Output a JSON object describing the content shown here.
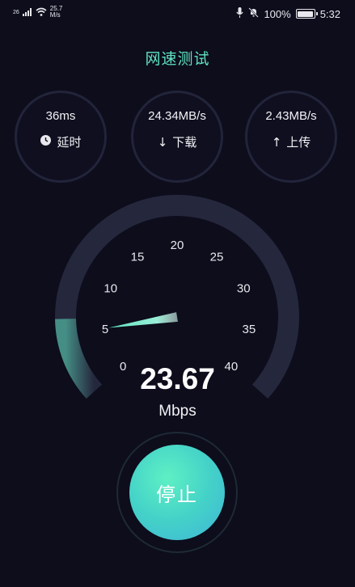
{
  "status_bar": {
    "signal": "26",
    "net_speed_value": "25.7",
    "net_speed_unit": "M/s",
    "battery_percent": "100%",
    "time": "5:32",
    "battery_level": 1.0
  },
  "header": {
    "title": "网速测试"
  },
  "stats": [
    {
      "value": "36ms",
      "label": "延时",
      "icon": "clock-icon"
    },
    {
      "value": "24.34MB/s",
      "label": "下载",
      "arrow": "↓",
      "icon": "download-arrow-icon"
    },
    {
      "value": "2.43MB/s",
      "label": "上传",
      "arrow": "↑",
      "icon": "upload-arrow-icon"
    }
  ],
  "gauge": {
    "ticks": [
      "0",
      "5",
      "10",
      "15",
      "20",
      "25",
      "30",
      "35",
      "40"
    ],
    "reading": "23.67",
    "unit": "Mbps",
    "needle_value": 5
  },
  "controls": {
    "stop_label": "停止"
  },
  "colors": {
    "accent": "#5fe3c0",
    "button_start": "#5ef0c4",
    "button_end": "#3fb4d8",
    "track": "#25273d"
  }
}
